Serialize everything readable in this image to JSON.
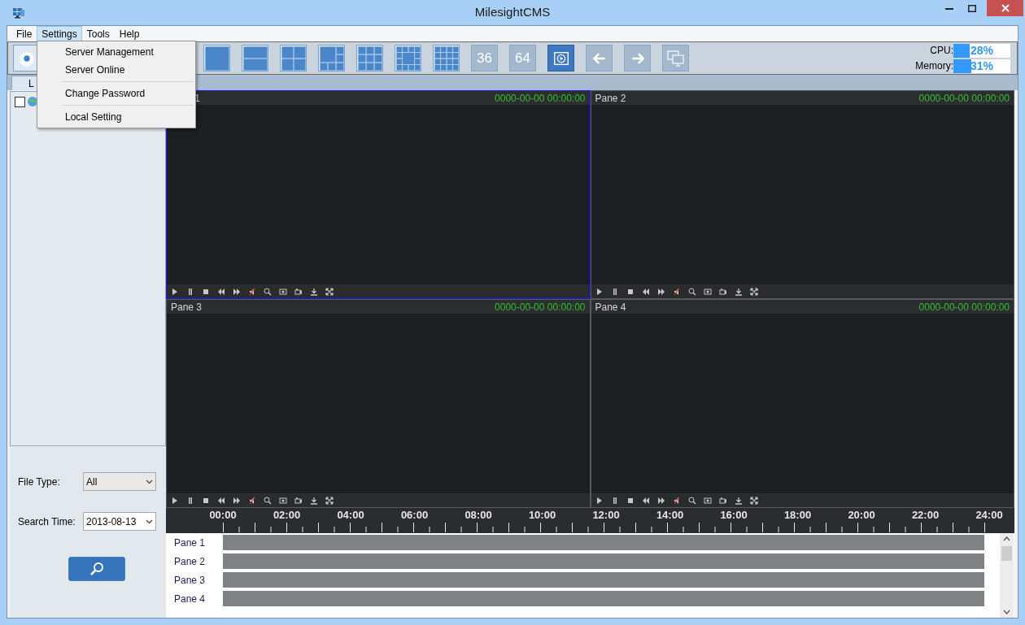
{
  "window": {
    "title": "MilesightCMS"
  },
  "menu": [
    {
      "label": "File",
      "selected": false
    },
    {
      "label": "Settings",
      "selected": true
    },
    {
      "label": "Tools",
      "selected": false
    },
    {
      "label": "Help",
      "selected": false
    }
  ],
  "open_menu": {
    "sections": [
      {
        "items": [
          {
            "label": "Server Management"
          },
          {
            "label": "Server Online"
          }
        ]
      },
      {
        "items": [
          {
            "label": "Change Password"
          }
        ]
      },
      {
        "items": [
          {
            "label": "Local Setting"
          }
        ]
      }
    ]
  },
  "toolbar": {
    "buttons": [
      {
        "kind": "gear",
        "selected": false
      },
      {
        "kind": "grid1",
        "selected": false
      },
      {
        "kind": "grid2",
        "selected": false
      },
      {
        "kind": "grid4",
        "selected": false
      },
      {
        "kind": "grid6",
        "selected": false
      },
      {
        "kind": "grid9",
        "selected": false
      },
      {
        "kind": "grid13",
        "selected": false
      },
      {
        "kind": "grid16",
        "selected": false
      },
      {
        "kind": "text",
        "label": "36",
        "selected": false
      },
      {
        "kind": "text",
        "label": "64",
        "selected": false
      },
      {
        "kind": "playback",
        "selected": true
      },
      {
        "kind": "back",
        "selected": false
      },
      {
        "kind": "forward",
        "selected": false
      },
      {
        "kind": "monitors",
        "selected": false
      }
    ]
  },
  "meters": [
    {
      "label": "CPU:",
      "level": 0.28,
      "reading": "28%"
    },
    {
      "label": "Memory:",
      "level": 0.31,
      "reading": "31%"
    }
  ],
  "tabs": [
    {
      "label": "L",
      "selected": true
    }
  ],
  "tree": {
    "items": [
      {
        "checked": false
      }
    ]
  },
  "filters": [
    {
      "label": "File Type:",
      "value": "All",
      "kind": "select"
    },
    {
      "label": "Search Time:",
      "value": "2013-08-13",
      "kind": "date"
    }
  ],
  "panes": [
    {
      "title": "1",
      "time": "0000-00-00 00:00:00",
      "selected": true
    },
    {
      "title": "Pane 2",
      "time": "0000-00-00 00:00:00",
      "selected": false
    },
    {
      "title": "Pane 3",
      "time": "0000-00-00 00:00:00",
      "selected": false
    },
    {
      "title": "Pane 4",
      "time": "0000-00-00 00:00:00",
      "selected": false
    }
  ],
  "timeline": {
    "labels": [
      "00:00",
      "02:00",
      "04:00",
      "06:00",
      "08:00",
      "10:00",
      "12:00",
      "14:00",
      "16:00",
      "18:00",
      "20:00",
      "22:00",
      "24:00"
    ]
  },
  "tracks": [
    {
      "label": "Pane 1"
    },
    {
      "label": "Pane 2"
    },
    {
      "label": "Pane 3"
    },
    {
      "label": "Pane 4"
    }
  ]
}
